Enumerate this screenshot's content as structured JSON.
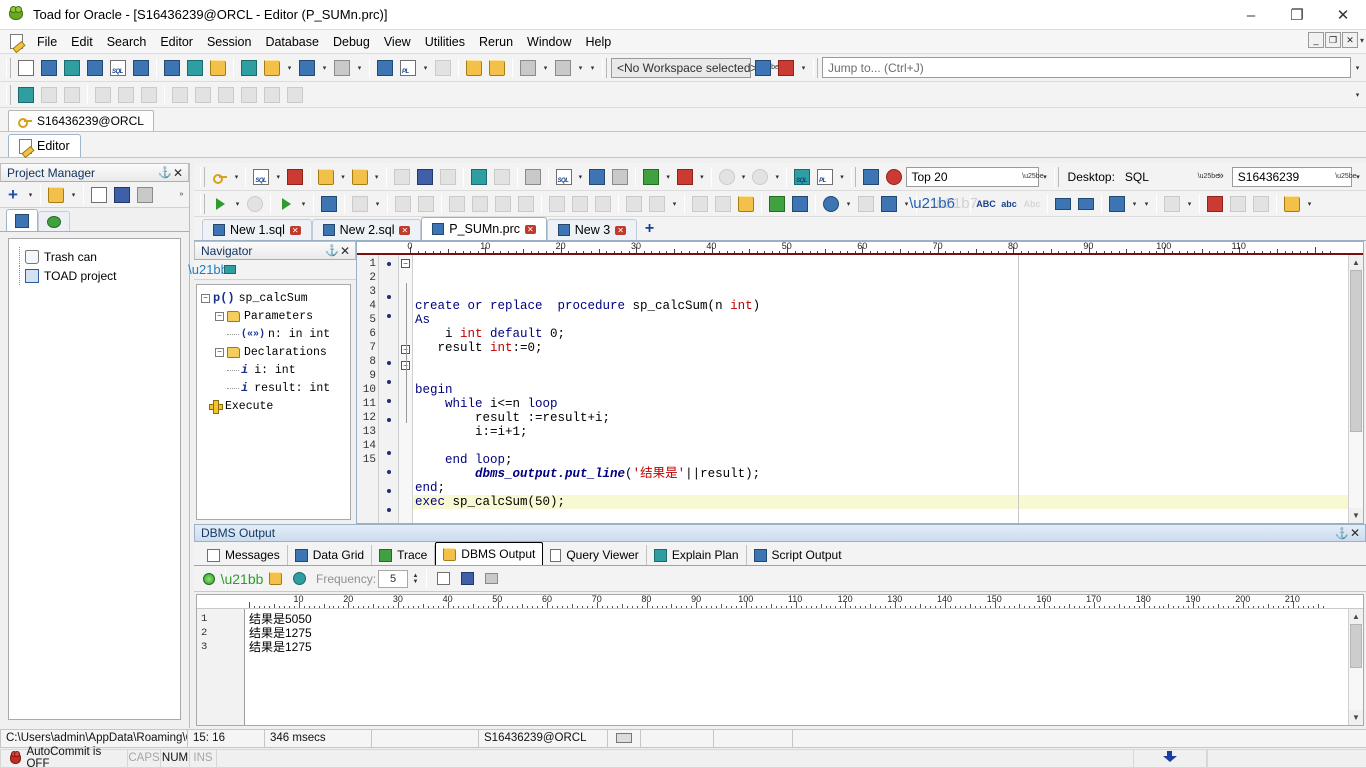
{
  "window": {
    "title": "Toad for Oracle - [S16436239@ORCL - Editor (P_SUMn.prc)]",
    "app_icon": "toad-frog-icon",
    "minimize": "–",
    "maximize": "❐",
    "close": "✕"
  },
  "menu": {
    "items": [
      {
        "label": "File"
      },
      {
        "label": "Edit"
      },
      {
        "label": "Search"
      },
      {
        "label": "Editor"
      },
      {
        "label": "Session"
      },
      {
        "label": "Database"
      },
      {
        "label": "Debug"
      },
      {
        "label": "View"
      },
      {
        "label": "Utilities"
      },
      {
        "label": "Rerun"
      },
      {
        "label": "Window"
      },
      {
        "label": "Help"
      }
    ],
    "mdi": {
      "minimize": "_",
      "restore": "❐",
      "close": "✕",
      "more": "▾"
    }
  },
  "main_toolbar": {
    "workspace_combo": "<No Workspace selected>",
    "jump_to_placeholder": "Jump to... (Ctrl+J)",
    "overflow": "▾"
  },
  "connection_tabs": [
    {
      "label": "S16436239@ORCL",
      "icon": "key-icon",
      "active": true
    }
  ],
  "editor_window_tabs": [
    {
      "label": "Editor",
      "icon": "editor-icon",
      "active": true
    }
  ],
  "editor_toolbar": {
    "rows_combo": "Top 20",
    "desktop_label": "Desktop:",
    "desktop_value": "SQL",
    "schema_combo": "S16436239",
    "chevron": "»"
  },
  "file_tabs": [
    {
      "label": "New 1.sql",
      "icon": "sql-file-icon",
      "close": "✕",
      "active": false
    },
    {
      "label": "New 2.sql",
      "icon": "sql-file-icon",
      "close": "✕",
      "active": false
    },
    {
      "label": "P_SUMn.prc",
      "icon": "sql-file-icon",
      "close": "✕",
      "active": true
    },
    {
      "label": "New 3",
      "icon": "sql-file-icon",
      "close": "✕",
      "active": false
    }
  ],
  "file_tabs_add": "+",
  "project_manager": {
    "title": "Project Manager",
    "pin": "📌",
    "close": "✕",
    "toolbar": {
      "add": "+",
      "open": "open-folder-icon",
      "new": "new-file-icon",
      "save": "save-icon",
      "print": "print-icon",
      "overflow": "»"
    },
    "tabs": [
      {
        "name": "projects-tab"
      },
      {
        "name": "database-tab"
      }
    ],
    "tree": [
      {
        "label": "Trash can",
        "icon": "trash-can-icon"
      },
      {
        "label": "TOAD project",
        "icon": "project-icon"
      }
    ]
  },
  "navigator": {
    "title": "Navigator",
    "pin": "📌",
    "close": "✕",
    "tree": [
      {
        "label": "sp_calcSum",
        "icon": "procedure-icon",
        "icon_text": "p()",
        "indent": 0,
        "expander": "−"
      },
      {
        "label": "Parameters",
        "icon": "folder-icon",
        "indent": 1,
        "expander": "−"
      },
      {
        "label": "n: in int",
        "icon": "parameter-icon",
        "icon_text": "(«»)",
        "indent": 2,
        "expander": ""
      },
      {
        "label": "Declarations",
        "icon": "folder-icon",
        "indent": 1,
        "expander": "−"
      },
      {
        "label": "i: int",
        "icon": "variable-icon",
        "icon_text": "i",
        "indent": 2,
        "expander": ""
      },
      {
        "label": "result: int",
        "icon": "variable-icon",
        "icon_text": "i",
        "indent": 2,
        "expander": ""
      },
      {
        "label": "Execute",
        "icon": "execute-plus-icon",
        "indent": 0,
        "expander": ""
      }
    ]
  },
  "code_editor": {
    "ruler_marks": [
      0,
      10,
      20,
      30,
      40,
      50,
      60,
      70,
      80,
      90,
      100,
      110
    ],
    "margin_column": 80,
    "current_line": 15,
    "lines": [
      {
        "n": 1,
        "dot": true,
        "fold": "−",
        "tokens": [
          {
            "t": "create or replace  procedure ",
            "c": "kw"
          },
          {
            "t": "sp_calcSum(",
            "c": "nm"
          },
          {
            "t": "n ",
            "c": "nm"
          },
          {
            "t": "int",
            "c": "ty"
          },
          {
            "t": ")",
            "c": "nm"
          }
        ]
      },
      {
        "n": 2,
        "dot": false,
        "fold": "",
        "tokens": [
          {
            "t": "As",
            "c": "kw"
          }
        ]
      },
      {
        "n": 3,
        "dot": true,
        "fold": "",
        "tokens": [
          {
            "t": "    i ",
            "c": "nm"
          },
          {
            "t": "int",
            "c": "ty"
          },
          {
            "t": " default ",
            "c": "kw"
          },
          {
            "t": "0;",
            "c": "nm"
          }
        ]
      },
      {
        "n": 4,
        "dot": true,
        "fold": "",
        "tokens": [
          {
            "t": "   result ",
            "c": "nm"
          },
          {
            "t": "int",
            "c": "ty"
          },
          {
            "t": ":=0;",
            "c": "nm"
          }
        ]
      },
      {
        "n": 5,
        "dot": false,
        "fold": "",
        "tokens": []
      },
      {
        "n": 6,
        "dot": false,
        "fold": "",
        "tokens": []
      },
      {
        "n": 7,
        "dot": true,
        "fold": "−",
        "tokens": [
          {
            "t": "begin",
            "c": "kw"
          }
        ]
      },
      {
        "n": 8,
        "dot": true,
        "fold": "−",
        "tokens": [
          {
            "t": "    ",
            "c": "nm"
          },
          {
            "t": "while",
            "c": "kw"
          },
          {
            "t": " i<=n ",
            "c": "nm"
          },
          {
            "t": "loop",
            "c": "kw"
          }
        ]
      },
      {
        "n": 9,
        "dot": true,
        "fold": "",
        "tokens": [
          {
            "t": "        result :=result+i;",
            "c": "nm"
          }
        ]
      },
      {
        "n": 10,
        "dot": true,
        "fold": "",
        "tokens": [
          {
            "t": "        i:=i+1;",
            "c": "nm"
          }
        ]
      },
      {
        "n": 11,
        "dot": false,
        "fold": "",
        "tokens": []
      },
      {
        "n": 12,
        "dot": true,
        "fold": "",
        "tokens": [
          {
            "t": "    ",
            "c": "nm"
          },
          {
            "t": "end loop",
            "c": "kw"
          },
          {
            "t": ";",
            "c": "nm"
          }
        ]
      },
      {
        "n": 13,
        "dot": true,
        "fold": "",
        "tokens": [
          {
            "t": "        ",
            "c": "nm"
          },
          {
            "t": "dbms_output.put_line",
            "c": "pkg"
          },
          {
            "t": "(",
            "c": "nm"
          },
          {
            "t": "'结果是'",
            "c": "str"
          },
          {
            "t": "||result);",
            "c": "nm"
          }
        ]
      },
      {
        "n": 14,
        "dot": true,
        "fold": "",
        "tokens": [
          {
            "t": "end",
            "c": "kw"
          },
          {
            "t": ";",
            "c": "nm"
          }
        ]
      },
      {
        "n": 15,
        "dot": true,
        "fold": "",
        "tokens": [
          {
            "t": "exec",
            "c": "kw"
          },
          {
            "t": " sp_calcSum(50);",
            "c": "nm"
          }
        ],
        "highlight": true
      }
    ]
  },
  "dbms_dock": {
    "title": "DBMS Output",
    "pin": "📌",
    "close": "✕",
    "tabs": [
      {
        "label": "Messages",
        "icon": "messages-icon",
        "active": false
      },
      {
        "label": "Data Grid",
        "icon": "data-grid-icon",
        "active": false
      },
      {
        "label": "Trace",
        "icon": "trace-icon",
        "active": false
      },
      {
        "label": "DBMS Output",
        "icon": "dbms-output-icon",
        "active": true
      },
      {
        "label": "Query Viewer",
        "icon": "query-viewer-icon",
        "active": false
      },
      {
        "label": "Explain Plan",
        "icon": "explain-plan-icon",
        "active": false
      },
      {
        "label": "Script Output",
        "icon": "script-output-icon",
        "active": false
      }
    ],
    "toolbar": {
      "toggle": "output-toggle-icon",
      "refresh": "refresh-icon",
      "poll": "poll-icon",
      "clock": "clock-icon",
      "frequency_label": "Frequency:",
      "frequency_value": "5",
      "clear": "clear-icon",
      "save": "save-icon",
      "print": "print-icon"
    },
    "ruler_marks": [
      10,
      20,
      30,
      40,
      50,
      60,
      70,
      80,
      90,
      100,
      110,
      120,
      130,
      140,
      150,
      160,
      170,
      180,
      190,
      200,
      210
    ],
    "output_lines": [
      {
        "n": "1",
        "text": "结果是5050"
      },
      {
        "n": "2",
        "text": "结果是1275"
      },
      {
        "n": "3",
        "text": "结果是1275"
      }
    ]
  },
  "statusbar": {
    "path": "C:\\Users\\admin\\AppData\\Roaming\\Q",
    "cursor": "15:  16",
    "elapsed": "346 msecs",
    "blank1": "",
    "connection": "S16436239@ORCL",
    "keyboard_icon": "keyboard-icon",
    "blank2": "",
    "blank3": "",
    "autocommit": "AutoCommit is OFF",
    "caps": "CAPS",
    "num": "NUM",
    "ins": "INS",
    "download_icon": "download-icon"
  },
  "colors": {
    "keyword": "#000080",
    "type": "#c00000",
    "string": "#c00000",
    "current_line": "#f8f8d2",
    "ruler_rule": "#7a0d10",
    "panel_header_text": "#123a63"
  }
}
